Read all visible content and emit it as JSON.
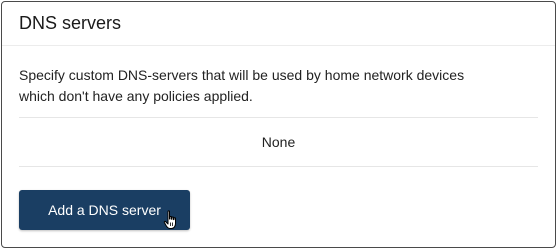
{
  "section": {
    "title": "DNS servers",
    "description_line1": "Specify custom DNS-servers that will be used by home network devices",
    "description_line2": "which don't have any policies applied.",
    "empty_text": "None",
    "add_button_label": "Add a DNS server"
  },
  "colors": {
    "button_bg": "#1a3e63",
    "button_text": "#ffffff",
    "border": "#4a4a4a"
  },
  "icons": {
    "cursor": "hand-pointer-icon"
  }
}
